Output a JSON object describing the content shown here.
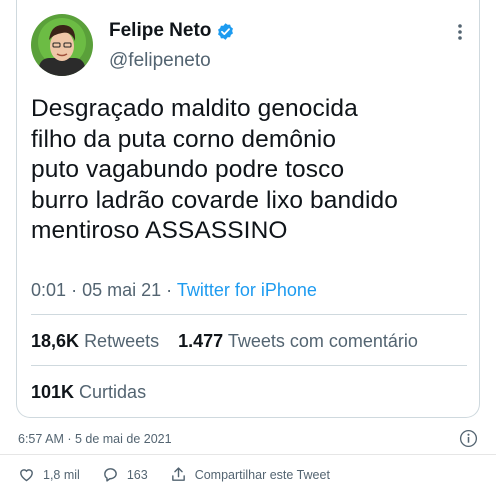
{
  "tweet": {
    "display_name": "Felipe Neto",
    "handle": "@felipeneto",
    "verified": true,
    "text_lines": [
      "Desgraçado maldito genocida",
      "filho da puta corno demônio",
      "puto vagabundo podre tosco",
      "burro ladrão covarde lixo bandido",
      "mentiroso ASSASSINO"
    ],
    "time": "0:01",
    "date": "05 mai 21",
    "separator": "·",
    "source": "Twitter for iPhone",
    "retweets_count": "18,6K",
    "retweets_label": "Retweets",
    "quotes_count": "1.477",
    "quotes_label": "Tweets com comentário",
    "likes_count": "101K",
    "likes_label": "Curtidas"
  },
  "embed": {
    "timestamp": "6:57 AM · 5 de mai de 2021",
    "like_count": "1,8 mil",
    "reply_count": "163",
    "share_label": "Compartilhar este Tweet"
  },
  "colors": {
    "accent": "#1d9bf0",
    "text": "#0f1419",
    "secondary": "#536471",
    "border": "#cfd9de"
  },
  "icons": [
    "verified-badge-icon",
    "more-icon",
    "info-icon",
    "heart-icon",
    "reply-icon",
    "share-icon"
  ]
}
